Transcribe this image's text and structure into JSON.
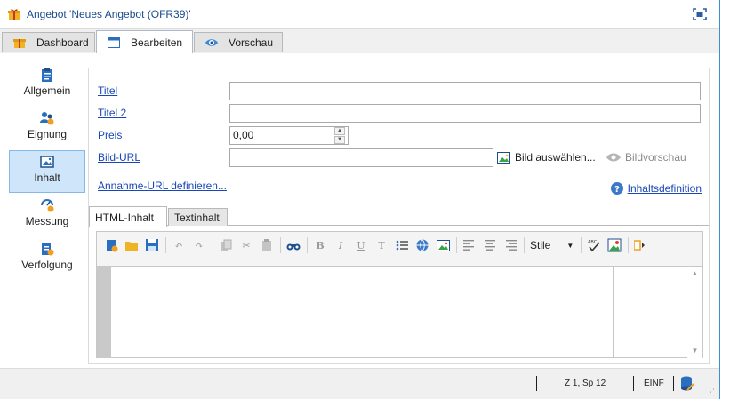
{
  "window": {
    "title": "Angebot 'Neues Angebot (OFR39)'"
  },
  "tabs": [
    {
      "label": "Dashboard",
      "icon": "gift-icon"
    },
    {
      "label": "Bearbeiten",
      "icon": "edit-window-icon",
      "active": true
    },
    {
      "label": "Vorschau",
      "icon": "eye-icon"
    }
  ],
  "sidebar": {
    "items": [
      {
        "label": "Allgemein",
        "icon": "clipboard-icon"
      },
      {
        "label": "Eignung",
        "icon": "users-icon"
      },
      {
        "label": "Inhalt",
        "icon": "image-icon",
        "active": true
      },
      {
        "label": "Messung",
        "icon": "measure-icon"
      },
      {
        "label": "Verfolgung",
        "icon": "tracking-icon"
      }
    ]
  },
  "form": {
    "title_label": "Titel",
    "title_value": "",
    "title2_label": "Titel 2",
    "title2_value": "",
    "price_label": "Preis",
    "price_value": "0,00",
    "image_url_label": "Bild-URL",
    "image_url_value": "",
    "choose_image_label": "Bild auswählen...",
    "image_preview_label": "Bildvorschau",
    "accept_url_link": "Annahme-URL definieren...",
    "content_definition_link": "Inhaltsdefinition"
  },
  "subtabs": [
    {
      "label": "HTML-Inhalt",
      "active": true
    },
    {
      "label": "Textinhalt"
    }
  ],
  "editor": {
    "style_select_value": "Stile",
    "toolbar_letters": {
      "bold": "B",
      "italic": "I",
      "underline": "U",
      "font": "T"
    }
  },
  "statusbar": {
    "position": "Z 1, Sp 12",
    "mode": "EINF"
  },
  "colors": {
    "accent": "#3c8fd6",
    "link": "#1a47b8",
    "selected": "#cfe5fa"
  }
}
